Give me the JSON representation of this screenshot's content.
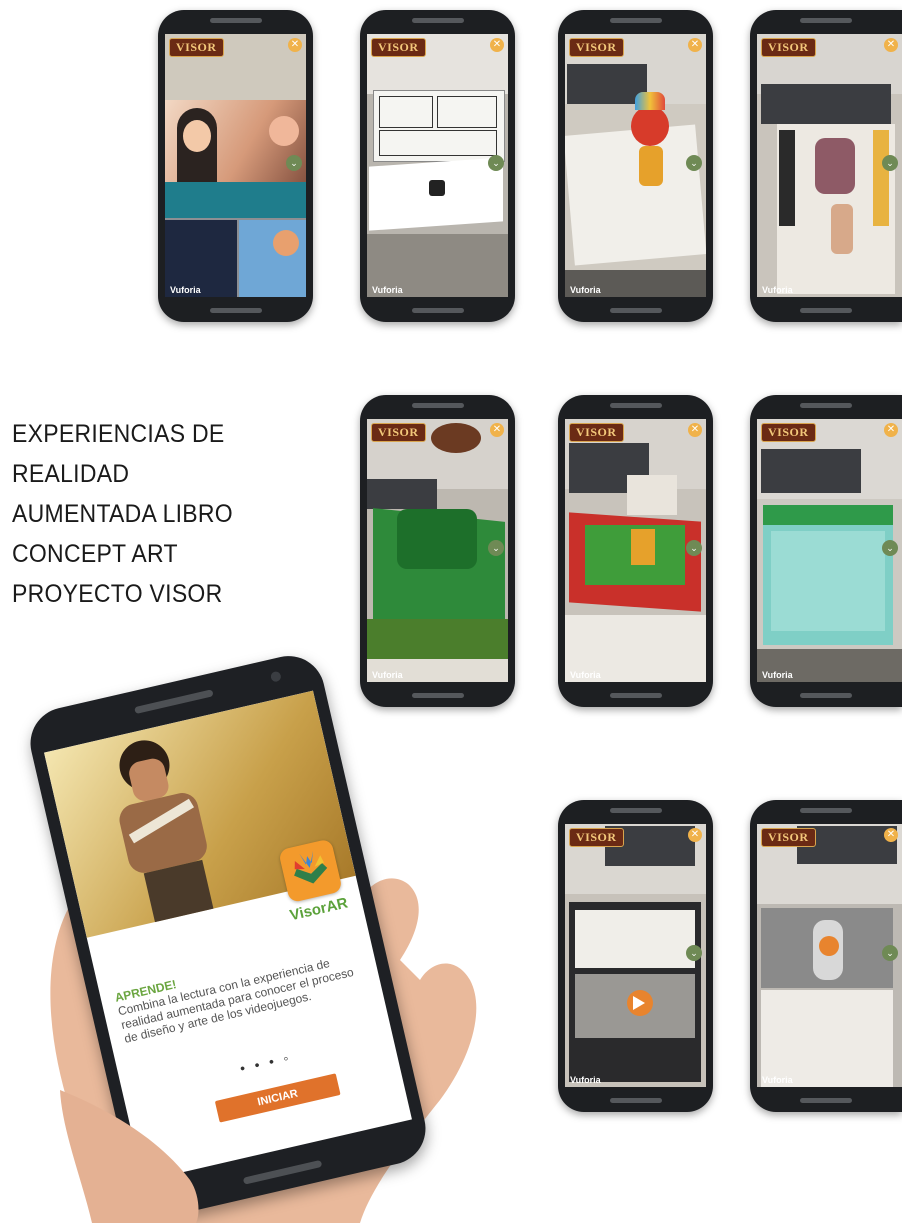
{
  "heading": {
    "lines": [
      "EXPERIENCIAS DE",
      "REALIDAD",
      "AUMENTADA LIBRO",
      "CONCEPT ART",
      "PROYECTO VISOR"
    ]
  },
  "phone_ui": {
    "logo": "VISOR",
    "close_icon": "close-icon",
    "vuforia": "Vuforia"
  },
  "hero_phone": {
    "app_name": "VisorAR",
    "kicker": "APRENDE!",
    "body": "Combina la lectura con la experiencia de realidad aumentada para conocer el proceso de diseño y arte de los videojuegos.",
    "pager": "• • • ◦",
    "cta": "INICIAR"
  },
  "colors": {
    "accent_orange": "#e0722b",
    "accent_green": "#6aa53f",
    "visor_brown": "#6b2a14"
  }
}
